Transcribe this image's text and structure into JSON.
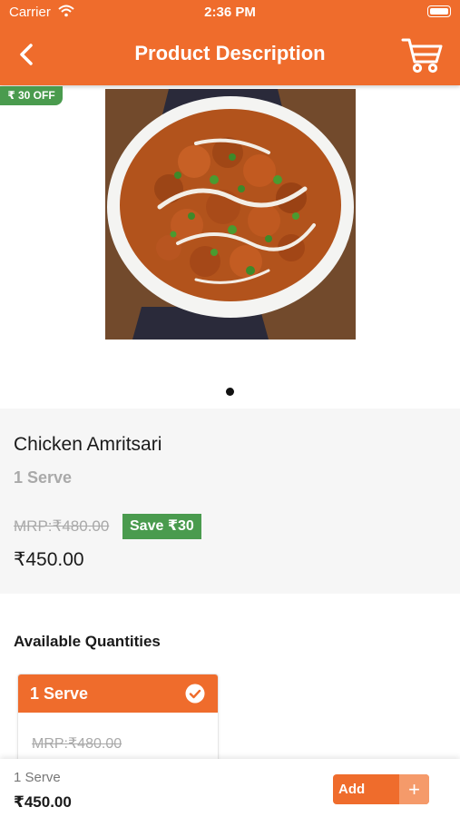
{
  "status_bar": {
    "carrier": "Carrier",
    "time": "2:36 PM",
    "wifi_icon": "wifi-icon",
    "battery_icon": "battery-icon"
  },
  "header": {
    "title": "Product Description",
    "back_icon": "chevron-left-icon",
    "cart_icon": "cart-icon",
    "color": "#ef6c2c"
  },
  "product": {
    "discount_badge": "₹ 30 OFF",
    "name": "Chicken Amritsari",
    "serve": "1 Serve",
    "mrp": "MRP:₹480.00",
    "save": "Save ₹30",
    "price": "₹450.00"
  },
  "carousel": {
    "pages": 1,
    "active": 1
  },
  "quantities": {
    "title": "Available Quantities",
    "options": [
      {
        "label": "1 Serve",
        "mrp": "MRP:₹480.00",
        "selected": true
      }
    ]
  },
  "bottom_bar": {
    "serve": "1 Serve",
    "price": "₹450.00",
    "add_label": "Add",
    "plus": "+"
  },
  "colors": {
    "accent": "#ef6c2c",
    "save_green": "#4a9b4e"
  }
}
